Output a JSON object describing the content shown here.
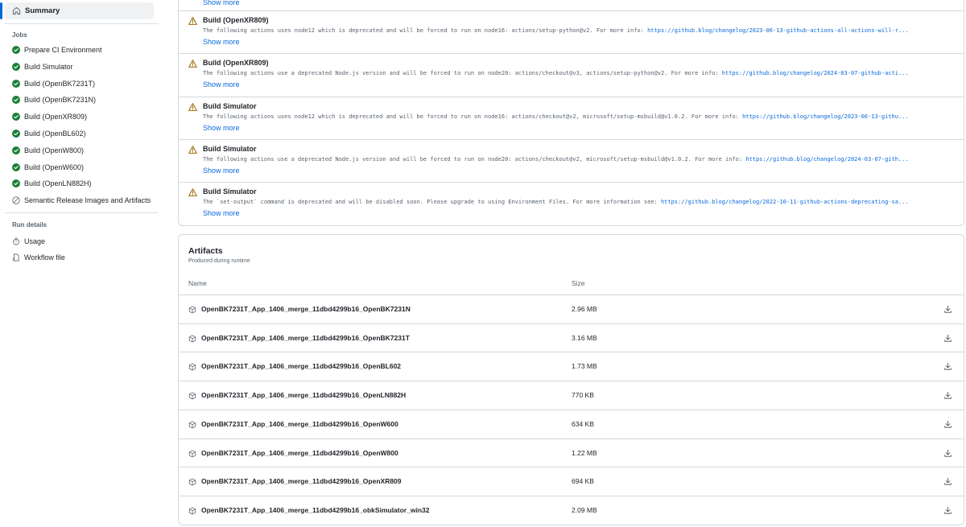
{
  "sidebar": {
    "summary_label": "Summary",
    "jobs_title": "Jobs",
    "jobs": [
      {
        "label": "Prepare CI Environment",
        "status": "success"
      },
      {
        "label": "Build Simulator",
        "status": "success"
      },
      {
        "label": "Build (OpenBK7231T)",
        "status": "success"
      },
      {
        "label": "Build (OpenBK7231N)",
        "status": "success"
      },
      {
        "label": "Build (OpenXR809)",
        "status": "success"
      },
      {
        "label": "Build (OpenBL602)",
        "status": "success"
      },
      {
        "label": "Build (OpenW800)",
        "status": "success"
      },
      {
        "label": "Build (OpenW600)",
        "status": "success"
      },
      {
        "label": "Build (OpenLN882H)",
        "status": "success"
      },
      {
        "label": "Semantic Release Images and Artifacts",
        "status": "skipped"
      }
    ],
    "run_details_title": "Run details",
    "run_details": [
      {
        "label": "Usage",
        "icon": "stopwatch-icon"
      },
      {
        "label": "Workflow file",
        "icon": "workflow-file-icon"
      }
    ]
  },
  "annotations": {
    "top_show_more": "Show more",
    "items": [
      {
        "title": "Build (OpenXR809)",
        "message": "The following actions uses node12 which is deprecated and will be forced to run on node16: actions/setup-python@v2. For more info: ",
        "link": "https://github.blog/changelog/2023-06-13-github-actions-all-actions-will-r...",
        "show_more": "Show more"
      },
      {
        "title": "Build (OpenXR809)",
        "message": "The following actions use a deprecated Node.js version and will be forced to run on node20: actions/checkout@v3, actions/setup-python@v2. For more info: ",
        "link": "https://github.blog/changelog/2024-03-07-github-acti...",
        "show_more": "Show more"
      },
      {
        "title": "Build Simulator",
        "message": "The following actions uses node12 which is deprecated and will be forced to run on node16: actions/checkout@v2, microsoft/setup-msbuild@v1.0.2. For more info: ",
        "link": "https://github.blog/changelog/2023-06-13-githu...",
        "show_more": "Show more"
      },
      {
        "title": "Build Simulator",
        "message": "The following actions use a deprecated Node.js version and will be forced to run on node20: actions/checkout@v2, microsoft/setup-msbuild@v1.0.2. For more info: ",
        "link": "https://github.blog/changelog/2024-03-07-gith...",
        "show_more": "Show more"
      },
      {
        "title": "Build Simulator",
        "message": "The `set-output` command is deprecated and will be disabled soon. Please upgrade to using Environment Files. For more information see: ",
        "link": "https://github.blog/changelog/2022-10-11-github-actions-deprecating-sa...",
        "show_more": "Show more"
      }
    ]
  },
  "artifacts": {
    "title": "Artifacts",
    "subtitle": "Produced during runtime",
    "col_name": "Name",
    "col_size": "Size",
    "rows": [
      {
        "name": "OpenBK7231T_App_1406_merge_11dbd4299b16_OpenBK7231N",
        "size": "2.96 MB"
      },
      {
        "name": "OpenBK7231T_App_1406_merge_11dbd4299b16_OpenBK7231T",
        "size": "3.16 MB"
      },
      {
        "name": "OpenBK7231T_App_1406_merge_11dbd4299b16_OpenBL602",
        "size": "1.73 MB"
      },
      {
        "name": "OpenBK7231T_App_1406_merge_11dbd4299b16_OpenLN882H",
        "size": "770 KB"
      },
      {
        "name": "OpenBK7231T_App_1406_merge_11dbd4299b16_OpenW600",
        "size": "634 KB"
      },
      {
        "name": "OpenBK7231T_App_1406_merge_11dbd4299b16_OpenW800",
        "size": "1.22 MB"
      },
      {
        "name": "OpenBK7231T_App_1406_merge_11dbd4299b16_OpenXR809",
        "size": "694 KB"
      },
      {
        "name": "OpenBK7231T_App_1406_merge_11dbd4299b16_obkSimulator_win32",
        "size": "2.09 MB"
      }
    ]
  },
  "colors": {
    "accent": "#0969da",
    "success": "#1a7f37",
    "warning": "#9a6700",
    "muted": "#59636e",
    "border": "#d1d9e0"
  }
}
